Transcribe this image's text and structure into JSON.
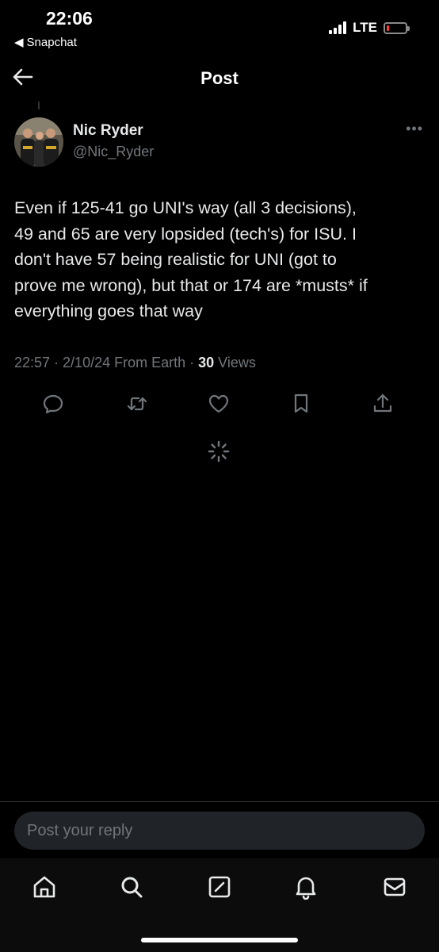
{
  "status_bar": {
    "time": "22:06",
    "back_app": "Snapchat",
    "network": "LTE",
    "colors": {
      "battery_low": "#ff3b30"
    },
    "battery_level": 0.12
  },
  "header": {
    "title": "Post",
    "back_icon": "back-arrow-icon"
  },
  "post": {
    "author_name": "Nic Ryder",
    "author_handle": "@Nic_Ryder",
    "more_icon": "more-options-icon",
    "text": "Even if 125-41 go UNI's way (all 3 decisions),\n49 and 65 are very lopsided (tech's) for ISU. I\ndon't have 57 being realistic for UNI (got to\nprove me wrong), but that or 174 are *musts* if\neverything goes that way",
    "meta_prefix": "22:57 · 2/10/24 From Earth · ",
    "views_count": "30",
    "views_label": " Views",
    "actions": [
      "reply-icon",
      "repost-icon",
      "like-icon",
      "bookmark-icon",
      "share-icon"
    ]
  },
  "reply": {
    "placeholder": "Post your reply"
  },
  "tabbar": {
    "items": [
      "home-icon",
      "search-icon",
      "compose-icon",
      "notifications-icon",
      "messages-icon"
    ]
  },
  "colors": {
    "background": "#000000",
    "text": "#e7e9ea",
    "secondary_text": "#71767b"
  }
}
